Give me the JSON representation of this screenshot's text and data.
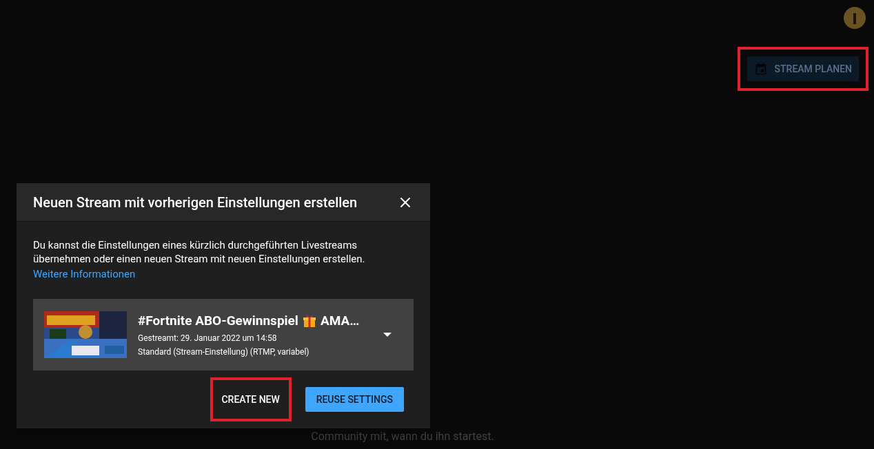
{
  "header": {
    "schedule_button": {
      "label": "STREAM PLANEN",
      "highlighted": true
    }
  },
  "background_text": "Community mit, wann du ihn startest.",
  "dialog": {
    "title": "Neuen Stream mit vorherigen Einstellungen erstellen",
    "description": "Du kannst die Einstellungen eines kürzlich durchgeführten Livestreams übernehmen oder einen neuen Stream mit neuen Einstellungen erstellen.",
    "link": "Weitere Informationen",
    "stream": {
      "title": "#Fortnite ABO-Gewinnspiel",
      "title_rest": "AMA…",
      "streamed": "Gestreamt: 29. Januar 2022 um 14:58",
      "settings": "Standard (Stream-Einstellung) (RTMP, variabel)"
    },
    "buttons": [
      {
        "label": "CREATE NEW",
        "kind": "text",
        "highlighted": true
      },
      {
        "label": "REUSE SETTINGS",
        "kind": "filled",
        "highlighted": false
      }
    ]
  }
}
